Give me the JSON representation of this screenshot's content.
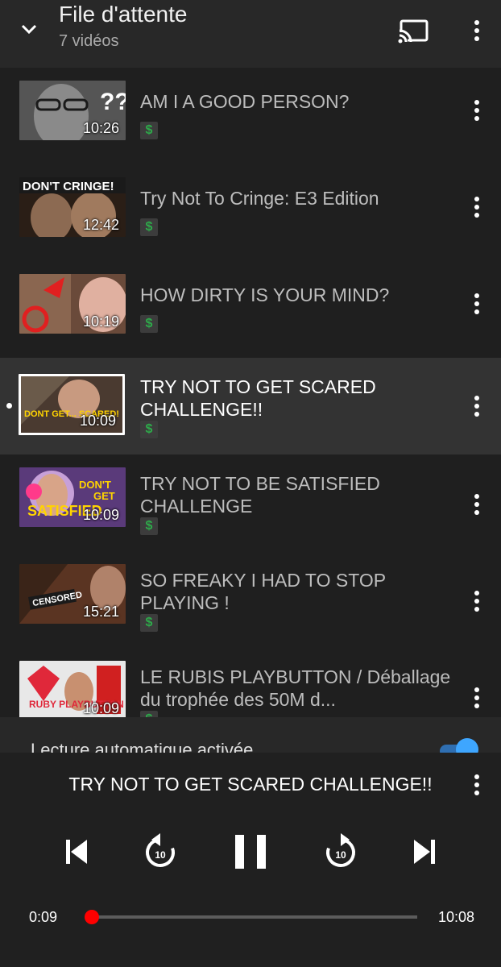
{
  "header": {
    "title": "File d'attente",
    "subtitle": "7 vidéos",
    "icons": {
      "collapse": "chevron-down-icon",
      "cast": "cast-icon",
      "more": "more-vert-icon"
    }
  },
  "queue": [
    {
      "title": "AM I A GOOD PERSON?",
      "duration": "10:26",
      "badge": "$",
      "active": false
    },
    {
      "title": "Try Not To Cringe: E3 Edition",
      "duration": "12:42",
      "badge": "$",
      "active": false,
      "thumb_text": "DON'T CRINGE!"
    },
    {
      "title": "HOW DIRTY IS YOUR MIND?",
      "duration": "10:19",
      "badge": "$",
      "active": false
    },
    {
      "title": "TRY NOT TO GET SCARED CHALLENGE!!",
      "duration": "10:09",
      "badge": "$",
      "active": true,
      "thumb_text": "DONT GET... SCARED!"
    },
    {
      "title": "TRY NOT TO BE SATISFIED CHALLENGE",
      "duration": "10:09",
      "badge": "$",
      "active": false,
      "thumb_text": "DON'T GET SATISFIED"
    },
    {
      "title": "SO FREAKY I HAD TO STOP PLAYING !",
      "duration": "15:21",
      "badge": "$",
      "active": false,
      "thumb_text": "CENSORED"
    },
    {
      "title": "LE RUBIS PLAYBUTTON  / Déballage du trophée des 50M d...",
      "duration": "10:09",
      "badge": "$",
      "active": false,
      "thumb_text": "RUBY PLAYBUTTON"
    }
  ],
  "autoplay": {
    "label": "Lecture automatique activée",
    "enabled": true
  },
  "player": {
    "title": "TRY NOT TO GET SCARED CHALLENGE!!",
    "current_time": "0:09",
    "total_time": "10:08",
    "progress": 0.015,
    "rewind_seconds": "10",
    "forward_seconds": "10",
    "state": "playing"
  },
  "colors": {
    "accent": "#ff0000",
    "toggle": "#3ea6ff",
    "badge_dollar": "#2eaa4a"
  }
}
